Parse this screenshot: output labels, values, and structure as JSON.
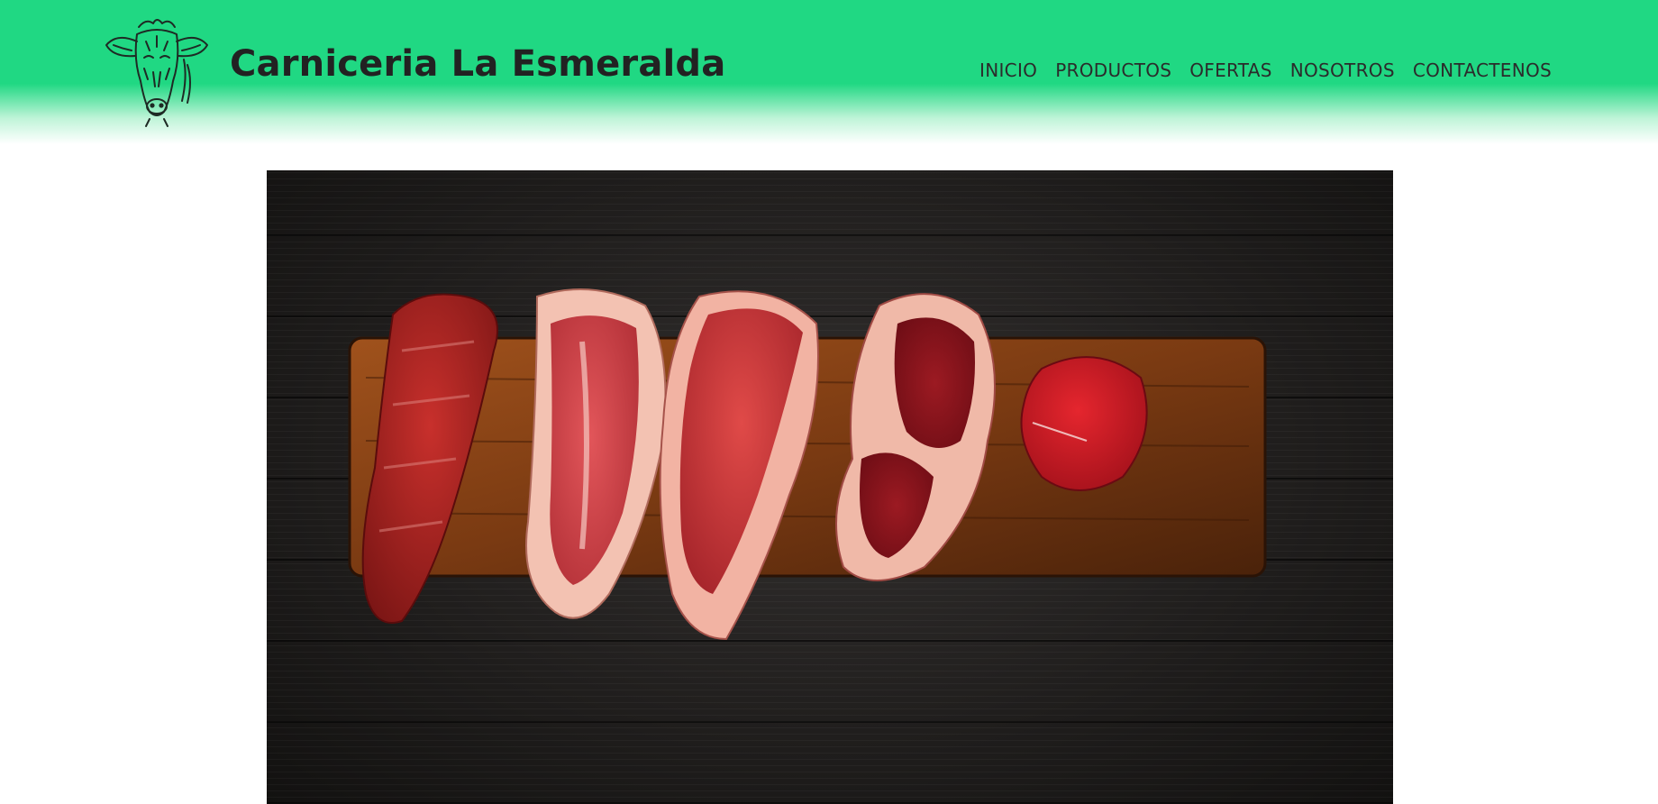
{
  "brand": {
    "name": "Carniceria La Esmeralda",
    "logo_icon": "cow-head-icon"
  },
  "nav": {
    "items": [
      "INICIO",
      "PRODUCTOS",
      "OFERTAS",
      "NOSOTROS",
      "CONTACTENOS"
    ]
  },
  "hero": {
    "image_subject": "raw-beef-steaks-on-cutting-board"
  },
  "colors": {
    "header_green": "#20d883",
    "text_dark": "#222222"
  }
}
